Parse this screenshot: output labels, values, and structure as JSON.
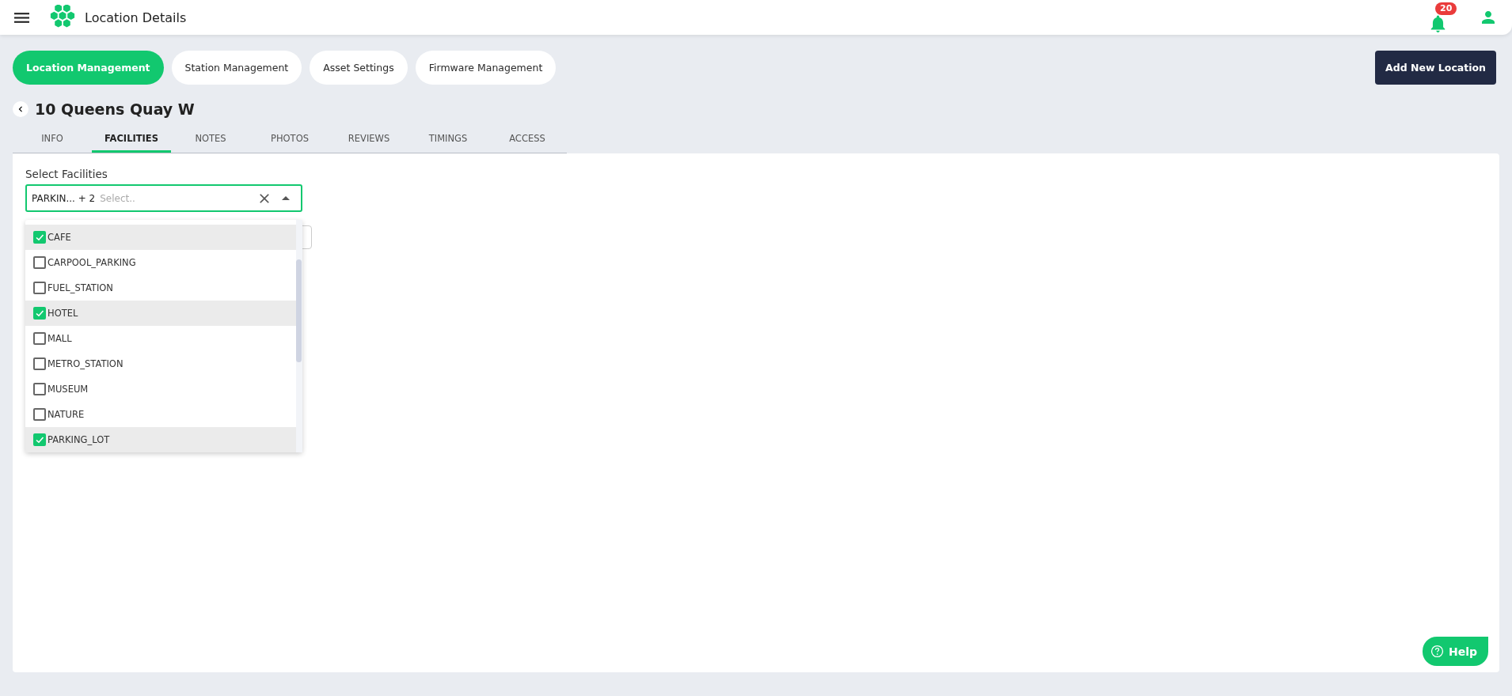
{
  "app_bar": {
    "title": "Location Details",
    "notification_count": "20"
  },
  "nav_pills": [
    {
      "label": "Location Management",
      "selected": true
    },
    {
      "label": "Station Management",
      "selected": false
    },
    {
      "label": "Asset Settings",
      "selected": false
    },
    {
      "label": "Firmware Management",
      "selected": false
    }
  ],
  "add_button": "Add New Location",
  "location_title": "10 Queens Quay W",
  "tabs": [
    {
      "label": "INFO",
      "selected": false
    },
    {
      "label": "FACILITIES",
      "selected": true
    },
    {
      "label": "NOTES",
      "selected": false
    },
    {
      "label": "PHOTOS",
      "selected": false
    },
    {
      "label": "REVIEWS",
      "selected": false
    },
    {
      "label": "TIMINGS",
      "selected": false
    },
    {
      "label": "ACCESS",
      "selected": false
    }
  ],
  "facilities_select": {
    "label": "Select Facilities",
    "value": "PARKIN... + 2",
    "placeholder": "Select..",
    "expanded": true,
    "options": [
      {
        "label": "CAFE",
        "checked": true
      },
      {
        "label": "CARPOOL_PARKING",
        "checked": false
      },
      {
        "label": "FUEL_STATION",
        "checked": false
      },
      {
        "label": "HOTEL",
        "checked": true
      },
      {
        "label": "MALL",
        "checked": false
      },
      {
        "label": "METRO_STATION",
        "checked": false
      },
      {
        "label": "MUSEUM",
        "checked": false
      },
      {
        "label": "NATURE",
        "checked": false
      },
      {
        "label": "PARKING_LOT",
        "checked": true
      }
    ]
  },
  "help_button": "Help"
}
